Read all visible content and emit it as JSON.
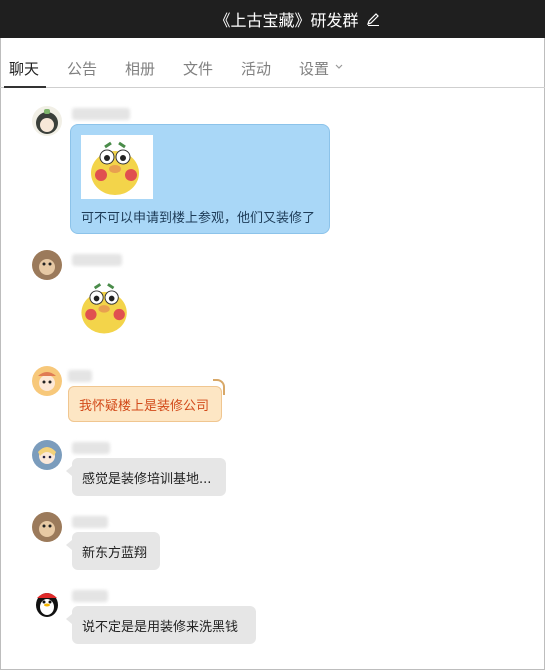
{
  "window": {
    "title": "《上古宝藏》研发群",
    "edit_icon": "pencil-icon"
  },
  "tabs": [
    {
      "label": "聊天",
      "active": true
    },
    {
      "label": "公告",
      "active": false
    },
    {
      "label": "相册",
      "active": false
    },
    {
      "label": "文件",
      "active": false
    },
    {
      "label": "活动",
      "active": false
    },
    {
      "label": "设置",
      "active": false,
      "has_dropdown": true
    }
  ],
  "messages": [
    {
      "avatar": "anime-girl-avatar",
      "bubble_style": "blue",
      "has_sticker": true,
      "text": "可不可以申请到楼上参观，他们又装修了"
    },
    {
      "avatar": "monkey-avatar",
      "bubble_style": "sticker",
      "has_sticker": true,
      "text": ""
    },
    {
      "avatar": "cartoon-girl-avatar",
      "bubble_style": "orange",
      "has_sticker": false,
      "text": "我怀疑楼上是装修公司"
    },
    {
      "avatar": "blonde-girl-avatar",
      "bubble_style": "gray",
      "has_sticker": false,
      "text": "感觉是装修培训基地..."
    },
    {
      "avatar": "monkey-avatar",
      "bubble_style": "gray",
      "has_sticker": false,
      "text": "新东方蓝翔"
    },
    {
      "avatar": "penguin-avatar",
      "bubble_style": "gray",
      "has_sticker": false,
      "text": "说不定是是用装修来洗黑钱"
    }
  ],
  "colors": {
    "titlebar": "#1f1f1f",
    "blue_bubble": "#a9d7f7",
    "orange_bubble": "#fde6c4",
    "orange_text": "#d24a1a",
    "gray_bubble": "#e6e6e6"
  }
}
